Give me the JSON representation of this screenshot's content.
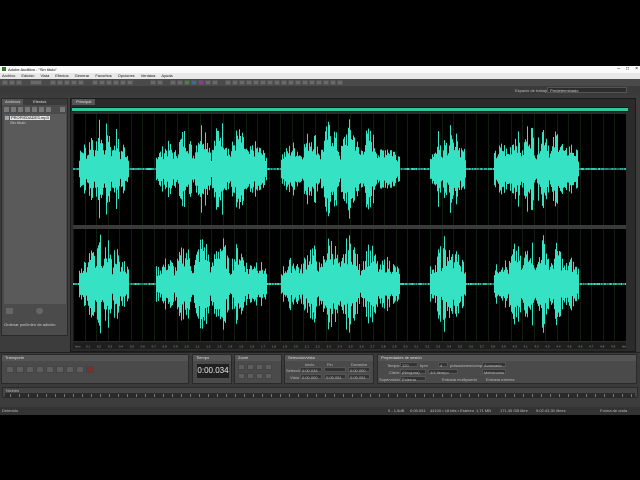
{
  "window": {
    "title": "Adobe Audition - \"Sin título\"",
    "controls": [
      "–",
      "□",
      "×"
    ]
  },
  "menu": [
    "Archivo",
    "Edición",
    "Vista",
    "Efectos",
    "Generar",
    "Favoritos",
    "Opciones",
    "Ventana",
    "Ayuda"
  ],
  "workspace": {
    "label": "Espacio de trabajo:",
    "value": "Predeterminado"
  },
  "files_panel": {
    "tabs": [
      "Archivos",
      "Efectos"
    ],
    "items": [
      {
        "name": "PROPIEDADES.mp3",
        "selected": true
      },
      {
        "name": "Sin título",
        "selected": false
      }
    ],
    "sort_label": "Ordenar por:",
    "sort_value": "Orden de adición"
  },
  "editor": {
    "tab": "Principal",
    "wave_color": "#35e3c4",
    "ruler_ticks": [
      "hms",
      "0.1",
      "0.2",
      "0.3",
      "0.4",
      "0.5",
      "0.6",
      "0.7",
      "0.8",
      "0.9",
      "1.0",
      "1.1",
      "1.2",
      "1.3",
      "1.4",
      "1.5",
      "1.6",
      "1.7",
      "1.8",
      "1.9",
      "2.0",
      "2.1",
      "2.2",
      "2.3",
      "2.4",
      "2.5",
      "2.6",
      "2.7",
      "2.8",
      "2.9",
      "3.0",
      "3.1",
      "3.2",
      "3.3",
      "3.4",
      "3.5",
      "3.6",
      "3.7",
      "3.8",
      "3.9",
      "4.0",
      "4.1",
      "4.2",
      "4.3",
      "4.4",
      "4.5",
      "4.6",
      "4.7",
      "4.8",
      "4.9",
      "hms"
    ]
  },
  "transport": {
    "label": "Transporte"
  },
  "time": {
    "label": "Tiempo",
    "value": "0:00.034"
  },
  "zoom": {
    "label": "Zoom"
  },
  "selection": {
    "label": "Selección/vista",
    "headers": [
      "Inicio",
      "Fin",
      "Duración"
    ],
    "rows": [
      {
        "label": "Selección",
        "start": "0:00.034",
        "end": "",
        "duration": "0:00.000"
      },
      {
        "label": "Vista",
        "start": "0:00.000",
        "end": "0:05.051",
        "duration": "0:05.051"
      }
    ]
  },
  "sample_props": {
    "label": "Propiedades de sesión",
    "tempo_label": "Tempo:",
    "tempo_value": "120",
    "tempo_unit": "bpm",
    "beats_label": "4",
    "beats_unit": "pulsaciones/compás",
    "advanced": "Avanzado...",
    "key_label": "Clave:",
    "key_value": "(Ninguna)",
    "time_sig_value": "4/4 tiempo",
    "metronome": "Metrónomo",
    "monitor_label": "Supervisión:",
    "monitor_value": "Externa",
    "stretch": "Entrada multipuerto",
    "stretch2": "Entrada externa"
  },
  "zoom_panel": {
    "label": "Niveles"
  },
  "status": {
    "left": "Detenido",
    "items": [
      "0 - 1,5dB",
      "0:05.051",
      "44100 • 16 bits • Estéreo",
      "1,71 MB",
      "171,35 GB libre",
      "9:02:43,30 libres",
      "Forma de onda"
    ]
  }
}
